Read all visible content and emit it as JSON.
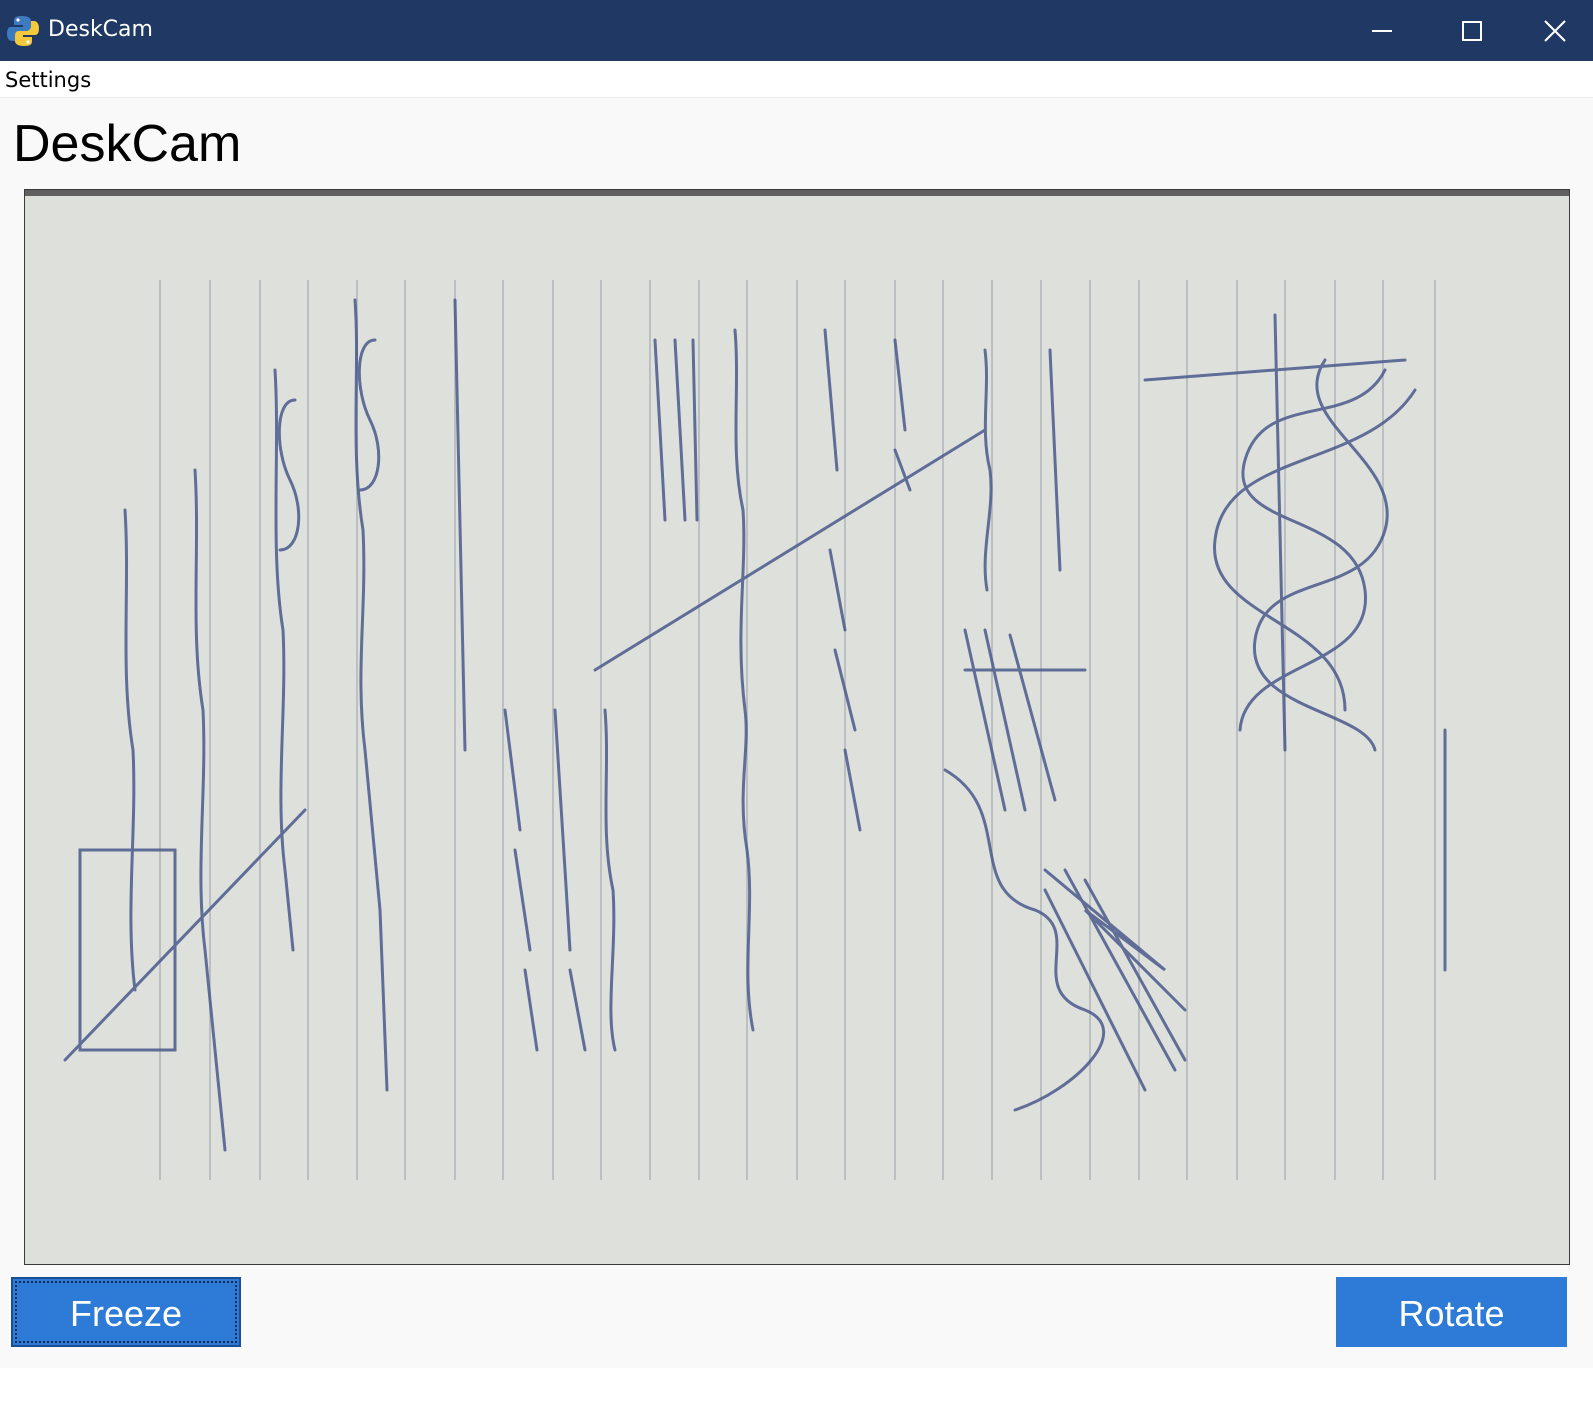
{
  "window": {
    "title": "DeskCam",
    "titlebar_color": "#1f3864",
    "controls": {
      "minimize_icon": "minimize-icon",
      "maximize_icon": "maximize-icon",
      "close_icon": "close-icon"
    }
  },
  "menu": {
    "items": [
      {
        "label": "Settings"
      }
    ]
  },
  "main": {
    "heading": "DeskCam",
    "camera_view": {
      "content": "live camera feed of a handwritten notebook page"
    }
  },
  "buttons": {
    "freeze_label": "Freeze",
    "rotate_label": "Rotate",
    "accent_color": "#2d7bd6"
  }
}
